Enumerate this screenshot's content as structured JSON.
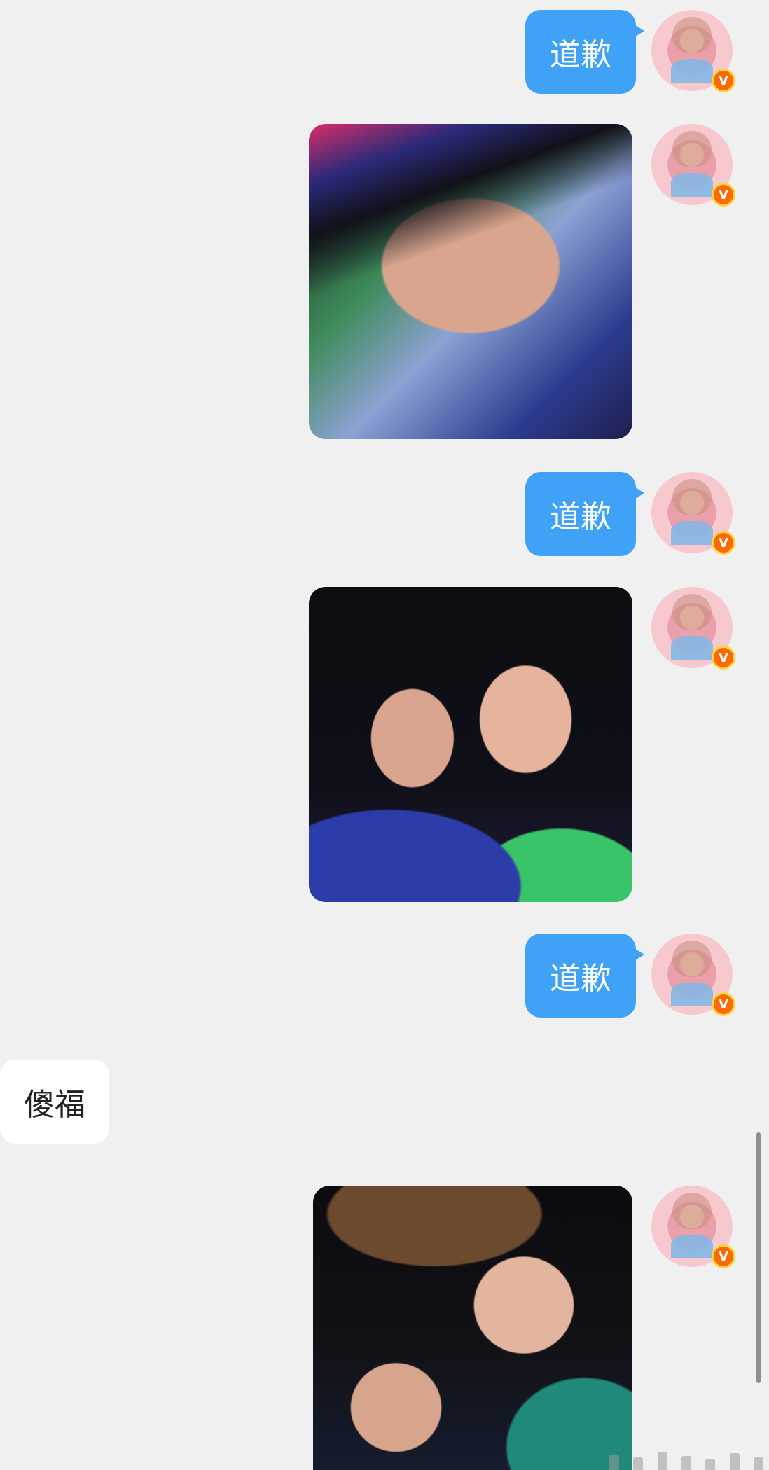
{
  "chat": {
    "messages": [
      {
        "type": "text",
        "side": "outgoing",
        "text": "道歉"
      },
      {
        "type": "image",
        "side": "outgoing"
      },
      {
        "type": "text",
        "side": "outgoing",
        "text": "道歉"
      },
      {
        "type": "image",
        "side": "outgoing"
      },
      {
        "type": "text",
        "side": "outgoing",
        "text": "道歉"
      },
      {
        "type": "text",
        "side": "incoming",
        "text": "傻福"
      },
      {
        "type": "image",
        "side": "outgoing"
      }
    ],
    "verified_badge_text": "V"
  },
  "colors": {
    "background": "#f0f0f0",
    "outgoing_bubble": "#3fa2f7",
    "incoming_bubble": "#ffffff",
    "verified_badge": "#ff6a00"
  },
  "icons": {
    "avatar": "user-avatar",
    "verified": "verified-v-badge-icon"
  }
}
